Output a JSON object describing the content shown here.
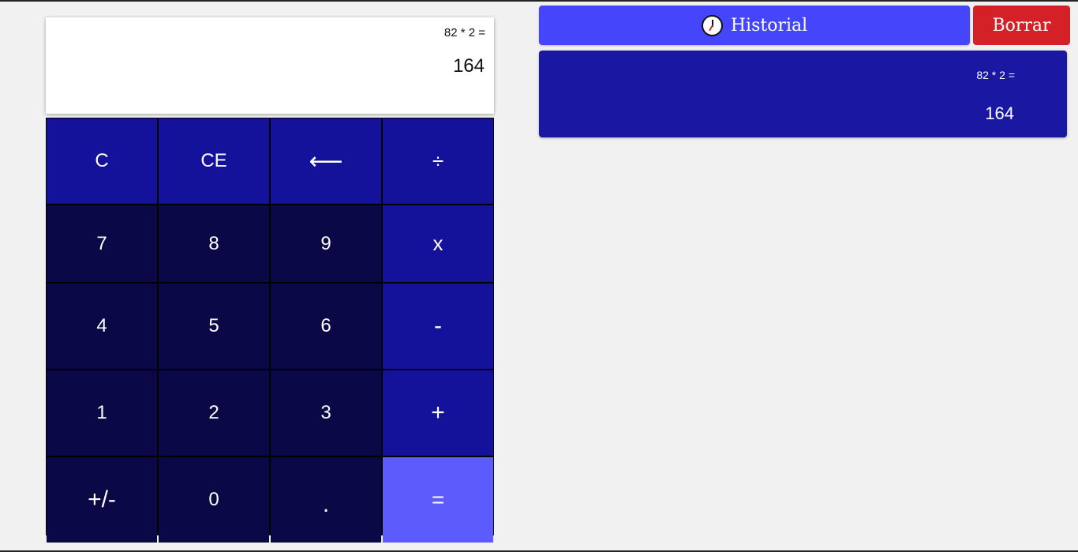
{
  "display": {
    "expression": "82 * 2 =",
    "result": "164"
  },
  "keys": {
    "clear": "C",
    "clear_entry": "CE",
    "backspace": "⟵",
    "divide": "÷",
    "seven": "7",
    "eight": "8",
    "nine": "9",
    "multiply": "x",
    "four": "4",
    "five": "5",
    "six": "6",
    "subtract": "-",
    "one": "1",
    "two": "2",
    "three": "3",
    "add": "+",
    "negate": "+/-",
    "zero": "0",
    "decimal": ".",
    "equals": "="
  },
  "history": {
    "title": "Historial",
    "clear_label": "Borrar",
    "icon": "clock-icon",
    "entries": [
      {
        "expression": "82 * 2 =",
        "result": "164"
      }
    ]
  },
  "colors": {
    "background": "#f1f1f1",
    "key_digit": "#0a0846",
    "key_operator": "#14129a",
    "key_equals": "#5c5cfc",
    "history_button": "#4546fb",
    "clear_button": "#d42027",
    "history_panel": "#1a18a3"
  }
}
